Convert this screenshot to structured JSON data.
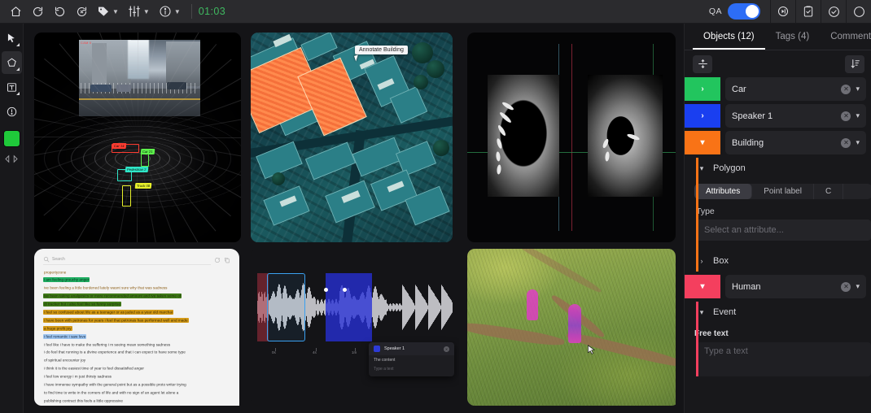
{
  "topbar": {
    "home_icon": "home-icon",
    "undo_icon": "undo-icon",
    "redo_icon": "redo-icon",
    "reset_icon": "reset-history-icon",
    "tag_icon": "tag-icon",
    "settings_icon": "sliders-icon",
    "info_icon": "info-icon",
    "timecode": "01:03",
    "qa_label": "QA",
    "qa_enabled": true,
    "right_icons": [
      "skip-to-end-icon",
      "clipboard-check-icon",
      "check-circle-icon",
      "check-icon"
    ]
  },
  "toolrail": {
    "tools": [
      {
        "name": "select-tool",
        "icon": "cursor-arrow-icon"
      },
      {
        "name": "polygon-tool",
        "icon": "polygon-icon"
      },
      {
        "name": "text-tool",
        "icon": "text-box-icon"
      },
      {
        "name": "issue-tool",
        "icon": "exclamation-circle-icon"
      }
    ],
    "color_swatch": "#1fc93a",
    "nav_prev_icon": "nav-left-icon",
    "nav_next_icon": "nav-right-icon"
  },
  "panels": {
    "lidar": {
      "title": "lidar-point-cloud-viewer",
      "camera_tag": "CAM 0",
      "boxes": [
        {
          "label": "Car 14",
          "color": "#ff3b30"
        },
        {
          "label": "Pedestrian 2",
          "color": "#2ee6c8"
        },
        {
          "label": "Truck 08",
          "color": "#e8f02a"
        },
        {
          "label": "Car 21",
          "color": "#5cf04a"
        }
      ]
    },
    "satellite": {
      "title": "satellite-imagery-viewer",
      "tooltip": "Annotate Building"
    },
    "medical": {
      "title": "medical-scan-viewer",
      "crosshair_colors": {
        "sagittal": "#7a2030",
        "coronal": "#2f8f52",
        "axial": "#31535f"
      }
    },
    "document": {
      "title": "text-annotation-viewer",
      "search_placeholder": "Search",
      "lines": [
        {
          "text": "propertyzone",
          "highlight": "none",
          "color": "#8a5a10"
        },
        {
          "text": "i am feeling grouchy anger",
          "highlight": "#1fae62",
          "color": "#07331c"
        },
        {
          "text": "ive been feeling a little burdened lately wasnt sure why that was sadness",
          "highlight": "none",
          "color": "#8a5a10"
        },
        {
          "text": "ive been taking analgesics or more recommended amount and ive taken some of",
          "highlight": "#3f7a18",
          "color": "#1c2d08"
        },
        {
          "text": "di tracker but i also feel like so funny surprise",
          "highlight": "#3f7a18",
          "color": "#1c2d08"
        },
        {
          "text": "i feel so confused about life as a teenager or as jaded as a year old marchai",
          "highlight": "#d49a16",
          "color": "#3b2a05"
        },
        {
          "text": "i have been with petronas for years i feel that petronas has performed well and made",
          "highlight": "#d49a16",
          "color": "#3b2a05"
        },
        {
          "text": "a huge profit joy",
          "highlight": "#d49a16",
          "color": "#3b2a05"
        },
        {
          "text": "i feel romantic i saw love",
          "highlight": "#9ec5f0",
          "color": "#10233a"
        },
        {
          "text": "i feel like i have to make the suffering i m seeing mean something sadness",
          "highlight": "none",
          "color": "#2f2f2f"
        },
        {
          "text": "i do feel that running is a divine experience and that i can expect to have some type",
          "highlight": "none",
          "color": "#2f2f2f"
        },
        {
          "text": "of spiritual encounter joy",
          "highlight": "none",
          "color": "#2f2f2f"
        },
        {
          "text": "i think it is the easiest time of year to feel dissatisfied anger",
          "highlight": "none",
          "color": "#2f2f2f"
        },
        {
          "text": "i feel low energy i m just thirsty sadness",
          "highlight": "none",
          "color": "#2f2f2f"
        },
        {
          "text": "i have immense sympathy with the general point but as a possible proto writer trying",
          "highlight": "none",
          "color": "#2f2f2f"
        },
        {
          "text": "to find time to write in the corners of life and with no sign of an agent let alone a",
          "highlight": "none",
          "color": "#2f2f2f"
        },
        {
          "text": "publishing contract this feels a little oppressive",
          "highlight": "none",
          "color": "#2f2f2f"
        }
      ]
    },
    "audio": {
      "title": "audio-waveform-viewer",
      "ticks": [
        "0s",
        "4s",
        "1m",
        "2m"
      ],
      "popup": {
        "speaker": "Speaker 1",
        "content_label": "The content",
        "text_placeholder": "Type a text",
        "color": "#2d3bd6"
      }
    },
    "drone": {
      "title": "drone-video-viewer",
      "mask_color": "#e23bc8"
    }
  },
  "right_panel": {
    "tabs": [
      {
        "label": "Objects (12)",
        "active": true
      },
      {
        "label": "Tags (4)",
        "active": false
      },
      {
        "label": "Comments",
        "active": false
      }
    ],
    "toolbar": {
      "collapse_icon": "collapse-all-icon",
      "sort_icon": "sort-descending-icon"
    },
    "objects": [
      {
        "name": "Car",
        "color": "#22c55e",
        "expanded": false
      },
      {
        "name": "Speaker 1",
        "color": "#1a3ff0",
        "expanded": false
      },
      {
        "name": "Building",
        "color": "#f97316",
        "expanded": true
      }
    ],
    "building_children": [
      {
        "label": "Polygon",
        "expanded": true
      },
      {
        "label": "Box",
        "expanded": false
      }
    ],
    "attribute_tabs": [
      {
        "label": "Attributes",
        "active": true
      },
      {
        "label": "Point label",
        "active": false
      },
      {
        "label": "C",
        "active": false
      }
    ],
    "type_label": "Type",
    "type_placeholder": "Select an attribute...",
    "human": {
      "name": "Human",
      "color": "#f43f5e",
      "expanded": true
    },
    "event_label": "Event",
    "free_text_label": "Free text",
    "free_text_placeholder": "Type a text"
  }
}
